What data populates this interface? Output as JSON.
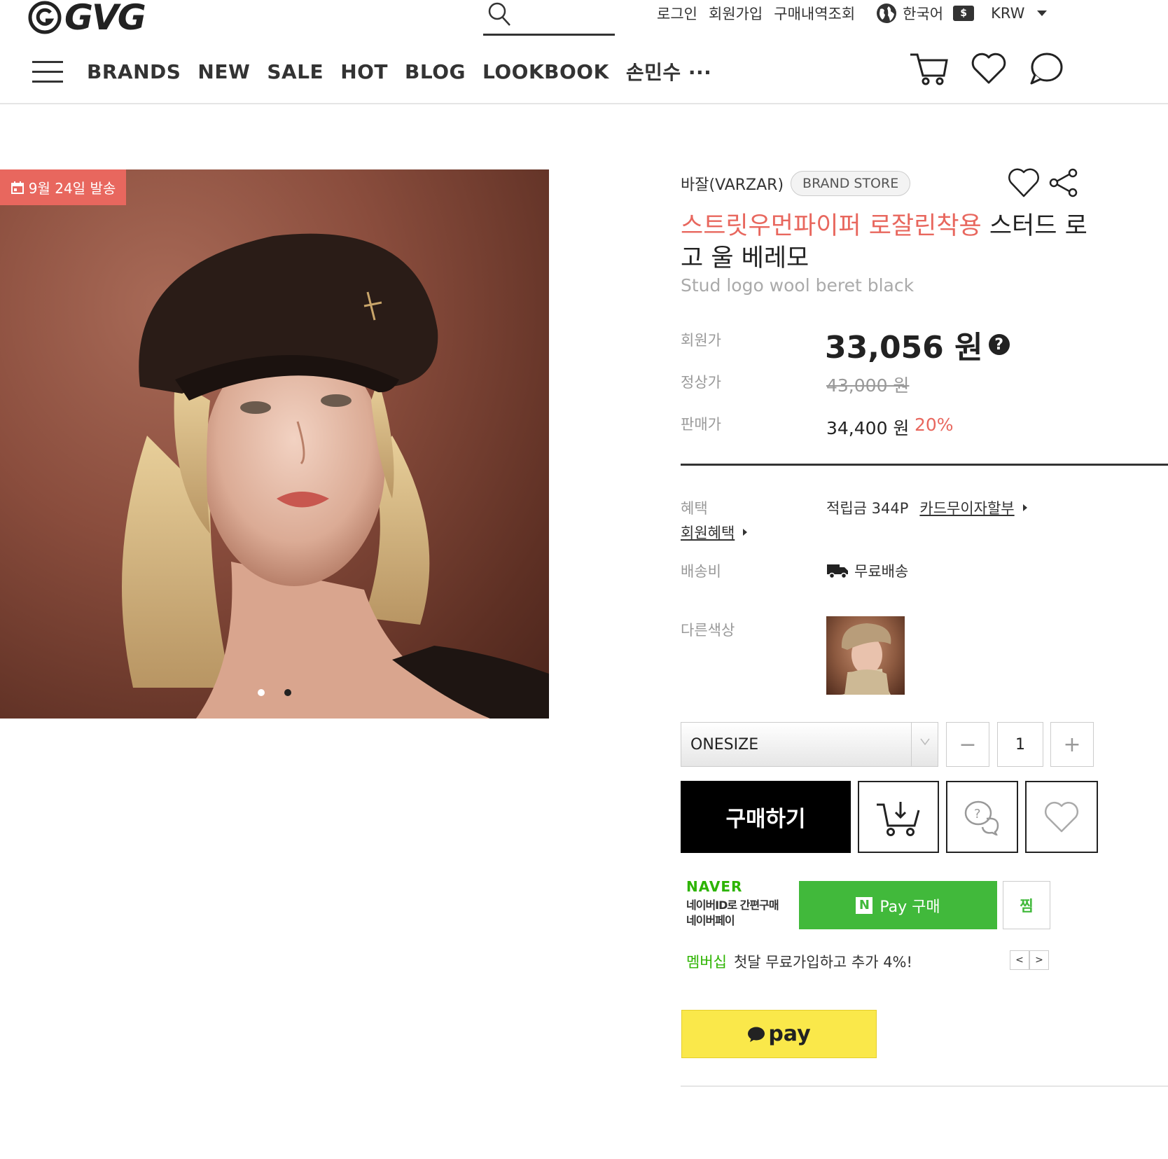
{
  "header": {
    "logo_text": "GVG",
    "top_links": [
      "로그인",
      "회원가입",
      "구매내역조회"
    ],
    "language": "한국어",
    "currency_symbol": "$",
    "currency": "KRW",
    "nav_items": [
      "BRANDS",
      "NEW",
      "SALE",
      "HOT",
      "BLOG",
      "LOOKBOOK",
      "손민수 ···"
    ]
  },
  "product": {
    "ship_badge": "9월 24일 발송",
    "image_slide_count": 2,
    "image_active_index": 0,
    "brand": "바잘(VARZAR)",
    "brand_store": "BRAND STORE",
    "title_highlight": "스트릿우먼파이퍼 로잘린착용",
    "title_rest": " 스터드 로고 울 베레모",
    "subtitle": "Stud logo wool beret black",
    "prices": {
      "member_label": "회원가",
      "member_price": "33,056 원",
      "member_help": "?",
      "list_label": "정상가",
      "list_price": "43,000 원",
      "sale_label": "판매가",
      "sale_price": "34,400 원",
      "discount": "20%"
    },
    "benefit_label": "혜택",
    "member_benefit": "회원혜택",
    "points": "적립금 344P",
    "card_installment": "카드무이자할부",
    "shipping_label": "배송비",
    "shipping_value": "무료배송",
    "other_colors_label": "다른색상"
  },
  "purchase": {
    "size_selected": "ONESIZE",
    "minus": "−",
    "plus": "+",
    "quantity": "1",
    "buy_label": "구매하기"
  },
  "naver": {
    "logo": "NAVER",
    "desc_line1": "네이버ID로 간편구매",
    "desc_line2": "네이버페이",
    "npay_n": "N",
    "npay_label": "Pay 구매",
    "zzim": "찜",
    "membership_label": "멤버십",
    "membership_text": "첫달 무료가입하고 추가 4%!",
    "prev": "<",
    "next": ">"
  },
  "kakao": {
    "pay_label": "pay"
  },
  "colors": {
    "accent": "#e8675e",
    "naver_green": "#41b93b",
    "kakao_yellow": "#fae84a"
  }
}
